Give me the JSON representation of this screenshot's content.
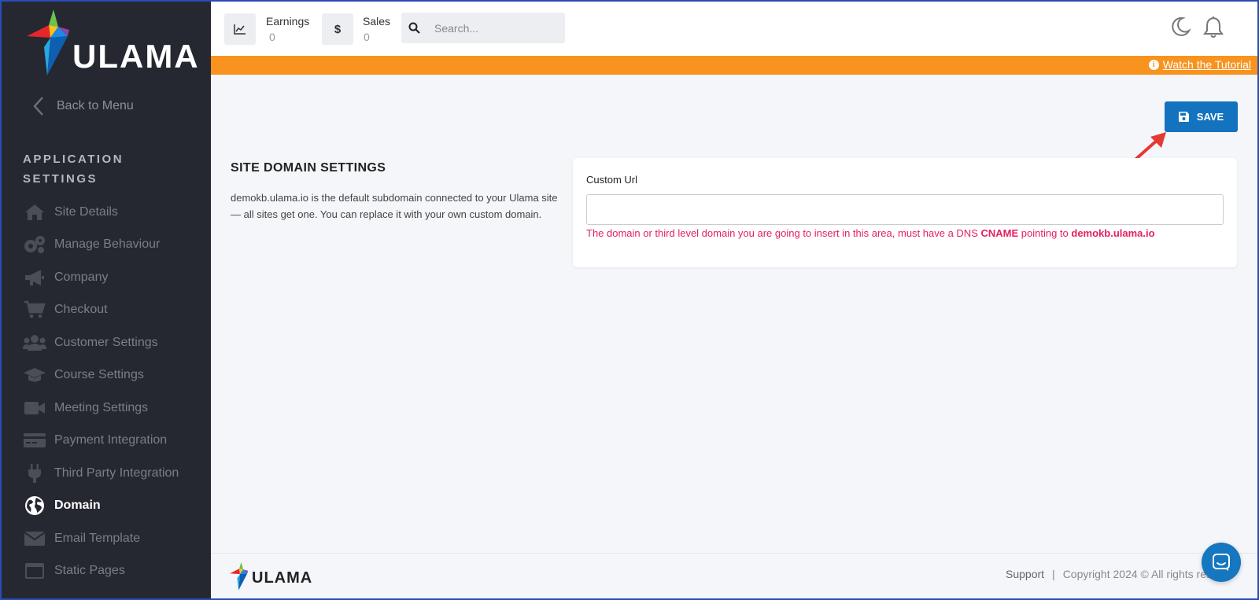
{
  "brand": {
    "name": "ULAMA",
    "accent": "#1473be",
    "banner_color": "#f7931e",
    "error_color": "#e5205e"
  },
  "sidebar": {
    "back_label": "Back to Menu",
    "section_title": "APPLICATION SETTINGS",
    "items": [
      {
        "label": "Site Details",
        "icon": "home-icon"
      },
      {
        "label": "Manage Behaviour",
        "icon": "gears-icon"
      },
      {
        "label": "Company",
        "icon": "megaphone-icon"
      },
      {
        "label": "Checkout",
        "icon": "cart-icon"
      },
      {
        "label": "Customer Settings",
        "icon": "users-icon"
      },
      {
        "label": "Course Settings",
        "icon": "graduation-cap-icon"
      },
      {
        "label": "Meeting Settings",
        "icon": "video-icon"
      },
      {
        "label": "Payment Integration",
        "icon": "credit-card-icon"
      },
      {
        "label": "Third Party Integration",
        "icon": "plug-icon"
      },
      {
        "label": "Domain",
        "icon": "globe-icon",
        "active": true
      },
      {
        "label": "Email Template",
        "icon": "envelope-icon"
      },
      {
        "label": "Static Pages",
        "icon": "window-icon"
      }
    ]
  },
  "topbar": {
    "earnings_label": "Earnings",
    "earnings_value": "0",
    "sales_label": "Sales",
    "sales_icon": "$",
    "sales_value": "0",
    "search_placeholder": "Search..."
  },
  "banner": {
    "tutorial_label": "Watch the Tutorial"
  },
  "main": {
    "save_label": "SAVE",
    "title": "SITE DOMAIN SETTINGS",
    "description": "demokb.ulama.io is the default subdomain connected to your Ulama site — all sites get one. You can replace it with your own custom domain.",
    "custom_url_label": "Custom Url",
    "custom_url_value": "",
    "hint_prefix": "The domain or third level domain you are going to insert in this area, must have a DNS ",
    "hint_cname": "CNAME",
    "hint_middle": " pointing to ",
    "hint_domain": "demokb.ulama.io"
  },
  "footer": {
    "support_label": "Support",
    "separator": "|",
    "copyright": "Copyright 2024 © All rights res"
  }
}
